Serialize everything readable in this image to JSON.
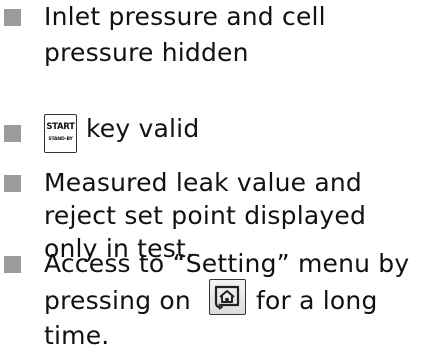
{
  "items": [
    {
      "lines": [
        "Inlet pressure and cell",
        "pressure hidden"
      ]
    },
    {
      "key": {
        "top_label": "START",
        "bottom_label": "STAND-BY",
        "icon": "start-standby-key"
      },
      "lines": [
        "key valid"
      ]
    },
    {
      "lines": [
        "Measured leak value and",
        "reject set point displayed",
        "only in test."
      ]
    },
    {
      "lines": [
        "Access to “Setting” menu by",
        "pressing on",
        "for a long",
        "time."
      ],
      "key": {
        "icon": "home-key"
      }
    }
  ],
  "colors": {
    "bullet": "#9b9b9b",
    "text": "#111111"
  }
}
